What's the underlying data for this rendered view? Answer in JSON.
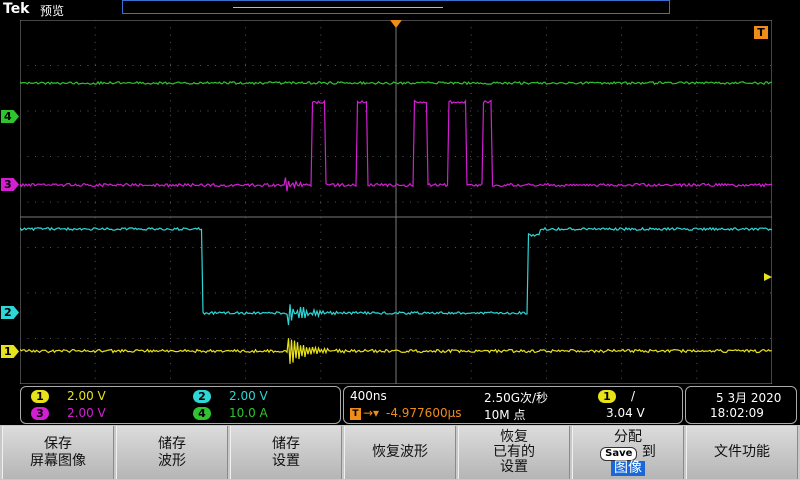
{
  "header": {
    "brand": "Tek",
    "mode": "预览"
  },
  "trigger": {
    "marker": "T"
  },
  "channels": [
    {
      "id": "1",
      "color": "#e8e21a",
      "scale": "2.00 V"
    },
    {
      "id": "2",
      "color": "#2ed6d6",
      "scale": "2.00 V"
    },
    {
      "id": "3",
      "color": "#d21fd2",
      "scale": "2.00 V"
    },
    {
      "id": "4",
      "color": "#2fc42f",
      "scale": "10.0 A"
    }
  ],
  "acquisition": {
    "timebase": "400ns",
    "sample_rate": "2.50G次/秒",
    "trigger_delay": "-4.977600µs",
    "record_length": "10M 点",
    "trigger_source": "1",
    "trigger_slope": "/",
    "trigger_level": "3.04 V"
  },
  "datetime": {
    "date": "5 3月 2020",
    "time": "18:02:09"
  },
  "softkeys": {
    "save_screen_line1": "保存",
    "save_screen_line2": "屏幕图像",
    "save_waveform_line1": "储存",
    "save_waveform_line2": "波形",
    "save_setup_line1": "储存",
    "save_setup_line2": "设置",
    "recall_waveform": "恢复波形",
    "recall_setup_line1": "恢复",
    "recall_setup_line2": "已有的",
    "recall_setup_line3": "设置",
    "assign_line1": "分配",
    "assign_save": "Save",
    "assign_to": "到",
    "assign_image": "图像",
    "file_utilities": "文件功能"
  }
}
